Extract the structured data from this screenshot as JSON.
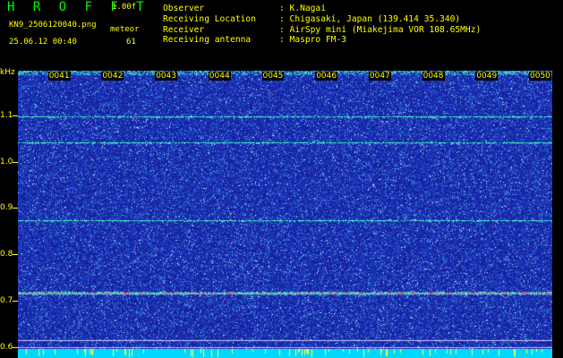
{
  "app": {
    "title": "H R O F F T",
    "version": "1.00f"
  },
  "file": {
    "name": "KN9_2506120040.png",
    "timestamp": "25.06.12 00:40"
  },
  "meteor": {
    "label": "meteor",
    "count": "61"
  },
  "info": [
    {
      "label": "Observer",
      "value": ": K.Nagai"
    },
    {
      "label": "Receiving Location",
      "value": ": Chigasaki, Japan (139.414 35.340)"
    },
    {
      "label": "Receiver",
      "value": ": AirSpy mini (Miakejima VOR 108.65MHz)"
    },
    {
      "label": "Receiving antenna",
      "value": ": Maspro FM-3"
    }
  ],
  "y_axis": {
    "unit": "kHz",
    "ticks": [
      {
        "value": 1.1,
        "label": "1.1"
      },
      {
        "value": 1.0,
        "label": "1.0"
      },
      {
        "value": 0.9,
        "label": "0.9"
      },
      {
        "value": 0.8,
        "label": "0.8"
      },
      {
        "value": 0.7,
        "label": "0.7"
      },
      {
        "value": 0.6,
        "label": "0.6"
      }
    ],
    "range": [
      0.577,
      1.196
    ]
  },
  "time_axis": {
    "markers": [
      "0041",
      "0042",
      "0043",
      "0044",
      "0045",
      "0046",
      "0047",
      "0048",
      "0049",
      "0050"
    ]
  },
  "spectrogram": {
    "carrier_lines_khz": [
      1.097,
      1.042,
      0.874,
      0.717
    ],
    "reference_lines_khz": [
      0.615,
      0.6
    ]
  },
  "colors": {
    "app_title": "#00ff00",
    "header_text": "#ffff00",
    "axis_text": "#ffff00",
    "background_noise": "#1a2aa8",
    "carrier": "#30ffc0",
    "strong_carrier": "#ff2060",
    "reference_line": "#c8c8ff",
    "baseline_strip": "#00d8ff"
  }
}
